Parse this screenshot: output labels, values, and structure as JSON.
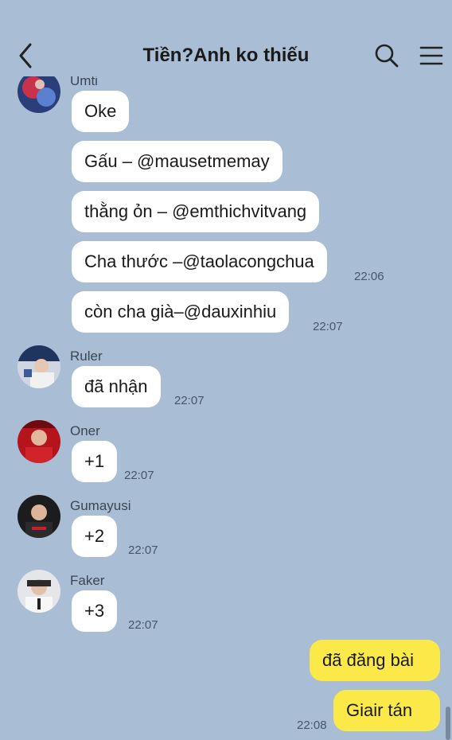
{
  "header": {
    "title": "Tiền?Anh ko thiếu",
    "back_icon": "chevron-left-icon",
    "search_icon": "search-icon",
    "menu_icon": "hamburger-menu-icon"
  },
  "colors": {
    "background": "#a9bdd5",
    "incoming_bubble": "#ffffff",
    "outgoing_bubble": "#fbe94a"
  },
  "messages": [
    {
      "sender": "Umti",
      "text": "Oke",
      "time": ""
    },
    {
      "sender": "Umti",
      "text": "Gấu – @mausetmemay",
      "time": ""
    },
    {
      "sender": "Umti",
      "text": "thằng ỏn – @emthichvitvang",
      "time": ""
    },
    {
      "sender": "Umti",
      "text": "Cha thước –@taolacongchua",
      "time": "22:06"
    },
    {
      "sender": "Umti",
      "text": "còn cha già–@dauxinhiu",
      "time": "22:07"
    },
    {
      "sender": "Ruler",
      "text": "đã nhận",
      "time": "22:07"
    },
    {
      "sender": "Oner",
      "text": "+1",
      "time": "22:07"
    },
    {
      "sender": "Gumayusi",
      "text": "+2",
      "time": "22:07"
    },
    {
      "sender": "Faker",
      "text": "+3",
      "time": "22:07"
    },
    {
      "sender": "me",
      "text": "đã đăng bài",
      "time": ""
    },
    {
      "sender": "me",
      "text": "Giair tán",
      "time": "22:08"
    }
  ]
}
